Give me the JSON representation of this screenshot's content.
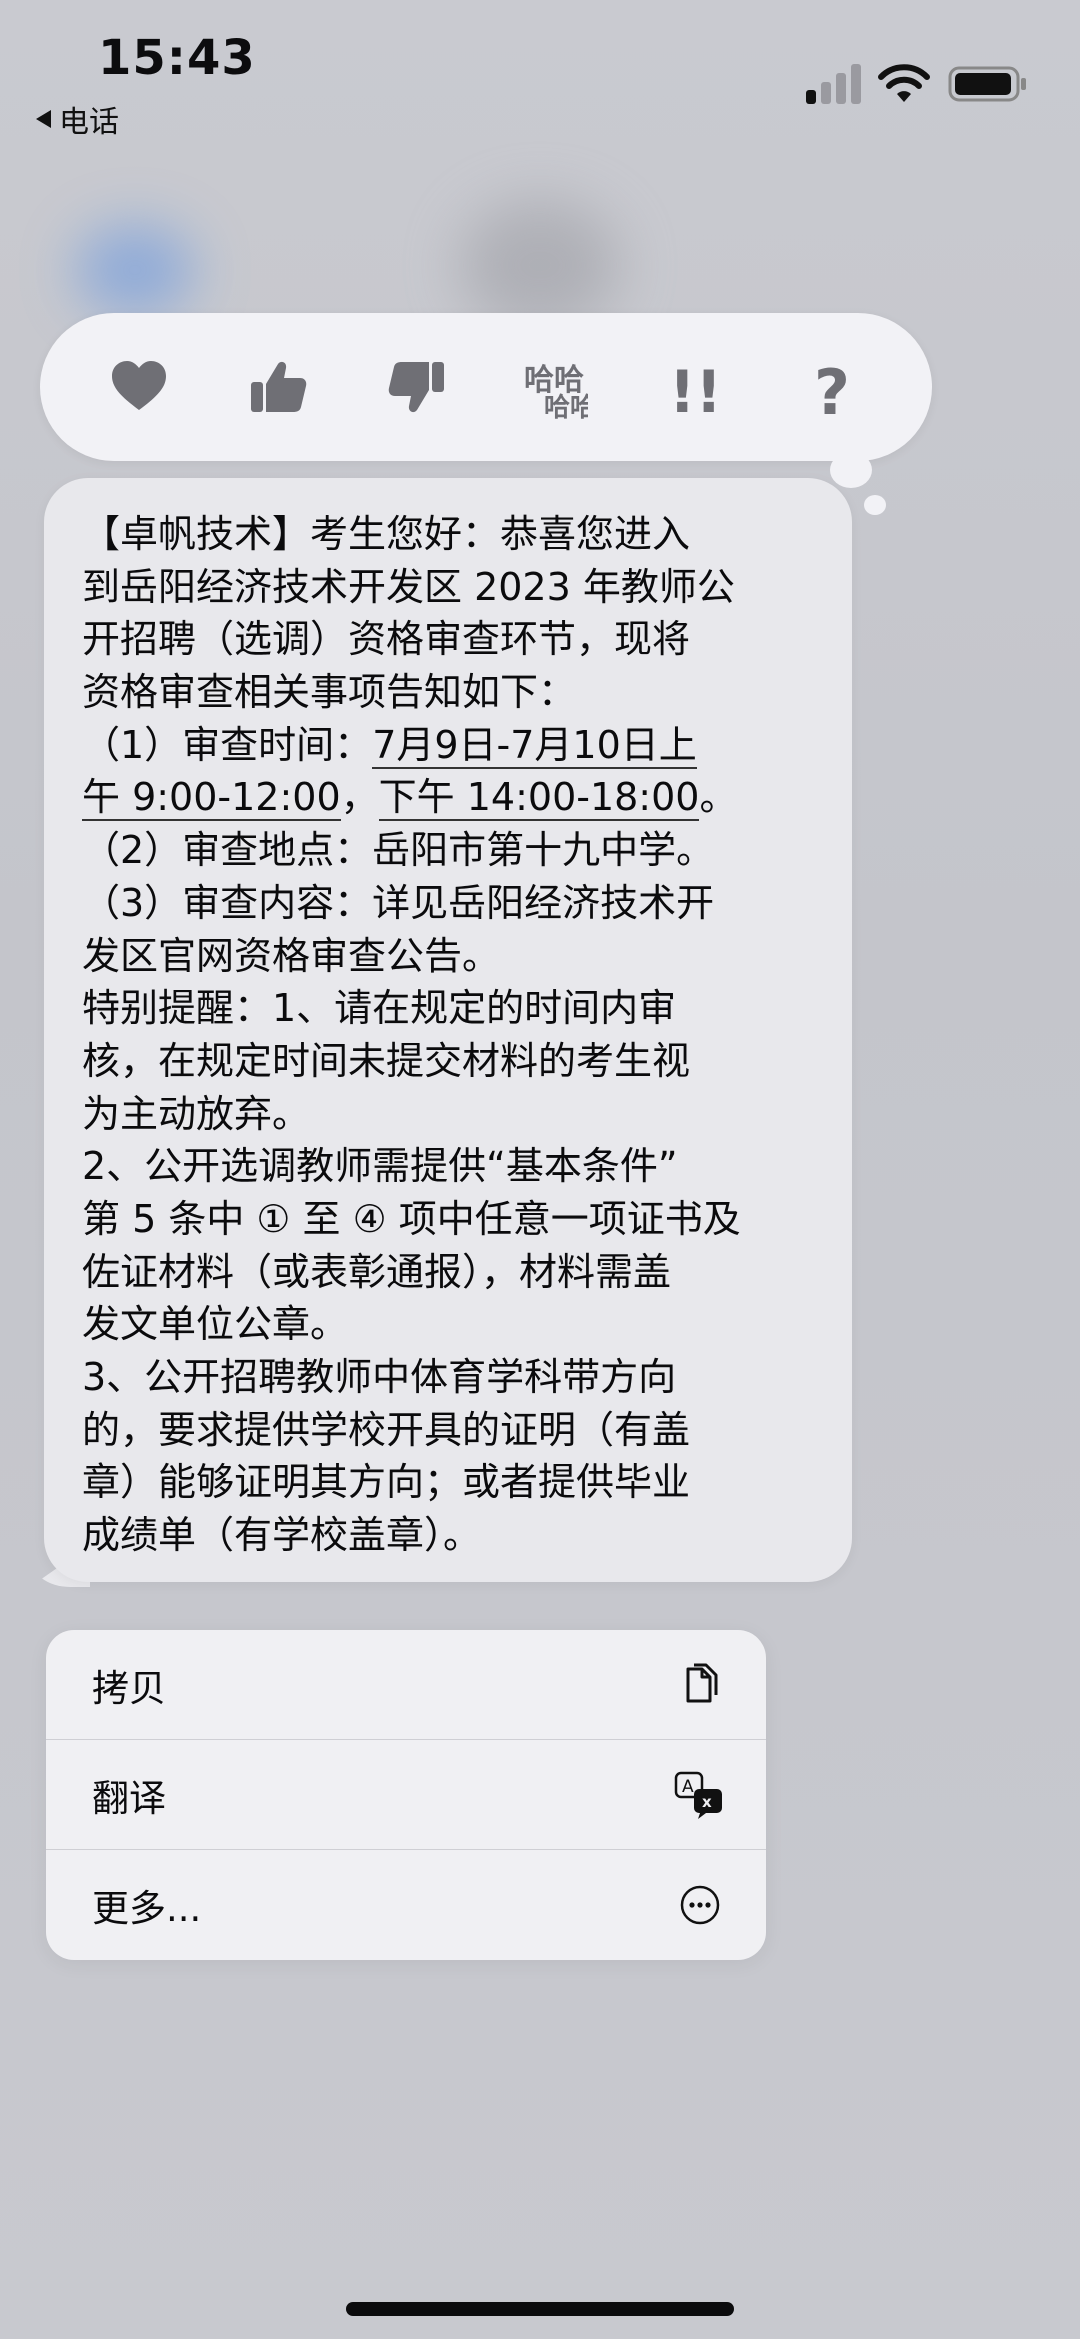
{
  "status_bar": {
    "time": "15:43",
    "back_app": "电话",
    "icons": [
      "signal-icon",
      "wifi-icon",
      "battery-icon"
    ]
  },
  "tapbacks": [
    {
      "name": "heart",
      "icon": "heart-icon"
    },
    {
      "name": "thumbs-up",
      "icon": "thumbs-up-icon"
    },
    {
      "name": "thumbs-down",
      "icon": "thumbs-down-icon"
    },
    {
      "name": "haha",
      "icon": "haha-icon",
      "text": "哈哈"
    },
    {
      "name": "emphasize",
      "icon": "double-exclamation-icon",
      "text": "!!"
    },
    {
      "name": "question",
      "icon": "question-icon",
      "text": "?"
    }
  ],
  "message": {
    "lines": [
      "【卓帆技术】考生您好：恭喜您进入",
      "到岳阳经济技术开发区 2023 年教师公",
      "开招聘（选调）资格审查环节，现将",
      "资格审查相关事项告知如下：",
      "",
      "",
      "（2）审查地点：岳阳市第十九中学。",
      "（3）审查内容：详见岳阳经济技术开",
      "发区官网资格审查公告。",
      "特别提醒：1、请在规定的时间内审",
      "核，在规定时间未提交材料的考生视",
      "为主动放弃。",
      "2、公开选调教师需提供“基本条件”",
      "第 5 条中 ① 至 ④ 项中任意一项证书及",
      "佐证材料（或表彰通报），材料需盖",
      "发文单位公章。",
      "3、公开招聘教师中体育学科带方向",
      "的，要求提供学校开具的证明（有盖",
      "章）能够证明其方向；或者提供毕业",
      "成绩单（有学校盖章）。"
    ],
    "line5_prefix": "（1）审查时间：",
    "line5_link": "7月9日-7月10日上",
    "line6_link_a": "午 9:00-12:00",
    "line6_sep": "，",
    "line6_link_b": "下午 14:00-18:00",
    "line6_suffix": "。"
  },
  "menu": {
    "items": [
      {
        "label": "拷贝",
        "icon": "copy-icon"
      },
      {
        "label": "翻译",
        "icon": "translate-icon"
      },
      {
        "label": "更多...",
        "icon": "more-icon"
      }
    ]
  },
  "colors": {
    "background": "#c7c8ce",
    "bubble": "#e8e8ec",
    "tapback_bar": "#f2f2f6",
    "icon_gray": "#6f6f75",
    "text": "#0b0b0d"
  }
}
